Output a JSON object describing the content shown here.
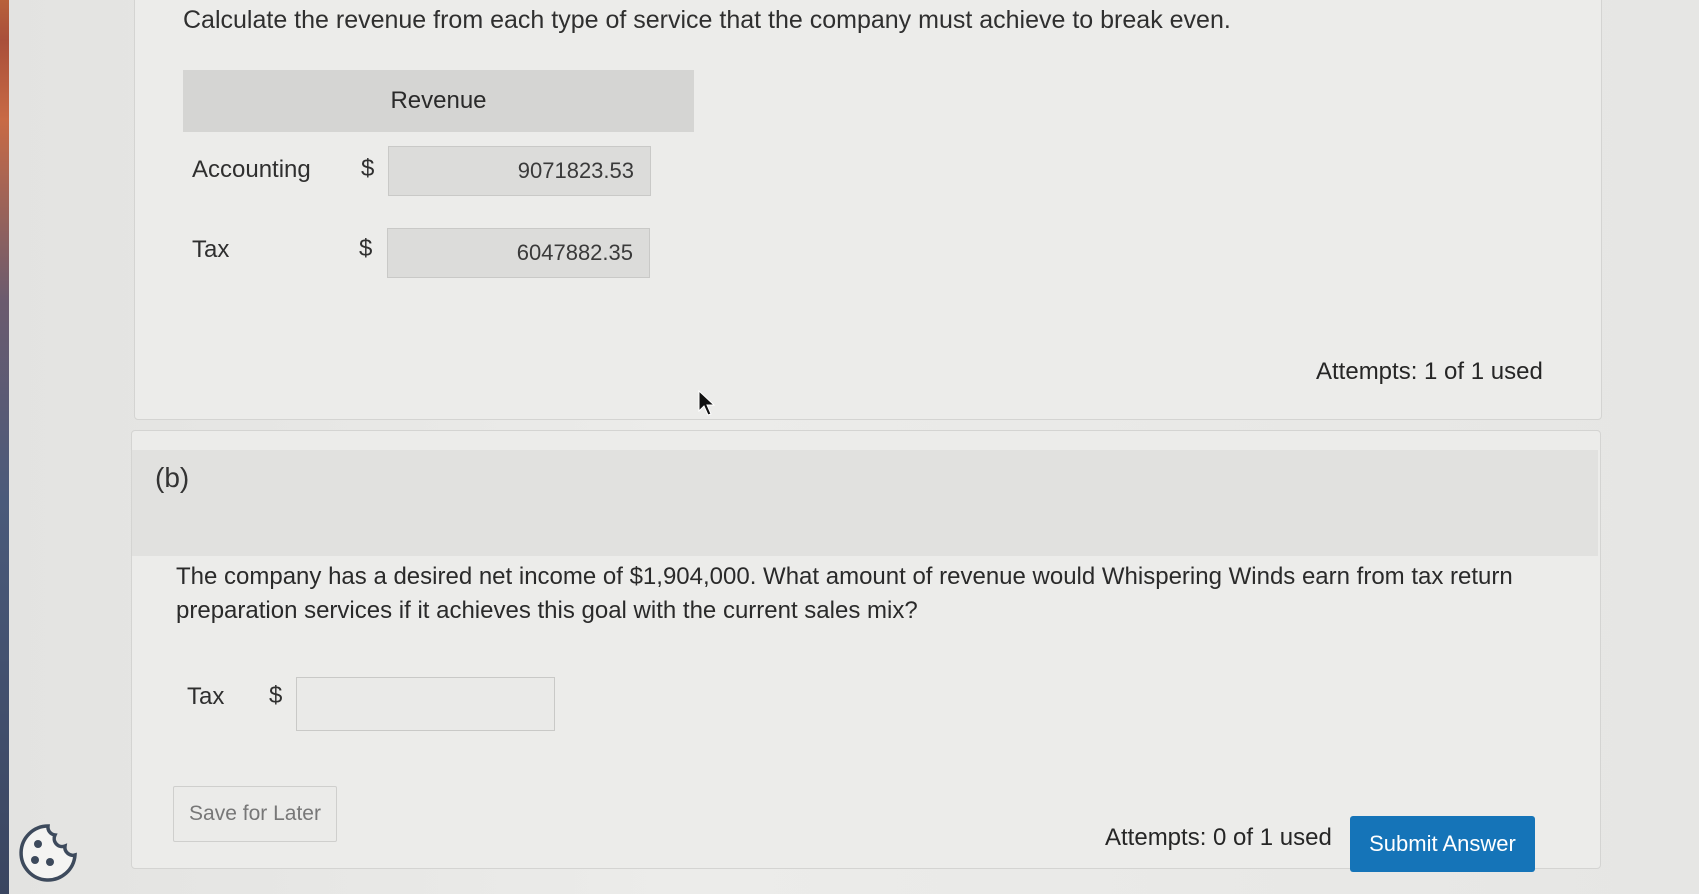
{
  "part_a": {
    "question": "Calculate the revenue from each type of service that the company must achieve to break even.",
    "table_header": "Revenue",
    "rows": [
      {
        "label": "Accounting",
        "currency": "$",
        "value": "9071823.53"
      },
      {
        "label": "Tax",
        "currency": "$",
        "value": "6047882.35"
      }
    ],
    "attempts": "Attempts: 1 of 1 used"
  },
  "part_b": {
    "label": "(b)",
    "question": "The company has a desired net income of $1,904,000. What amount of revenue would Whispering Winds earn from tax return preparation services if it achieves this goal with the current sales mix?",
    "input_label": "Tax",
    "currency": "$",
    "input_value": "",
    "save_label": "Save for Later",
    "attempts": "Attempts: 0 of 1 used",
    "submit_label": "Submit Answer"
  },
  "icons": {
    "cursor": "mouse-pointer-icon",
    "cookie": "cookie-settings-icon"
  },
  "colors": {
    "submit_bg": "#1574b8",
    "header_bg": "#d5d5d3",
    "value_box_bg": "#dcdcda"
  }
}
